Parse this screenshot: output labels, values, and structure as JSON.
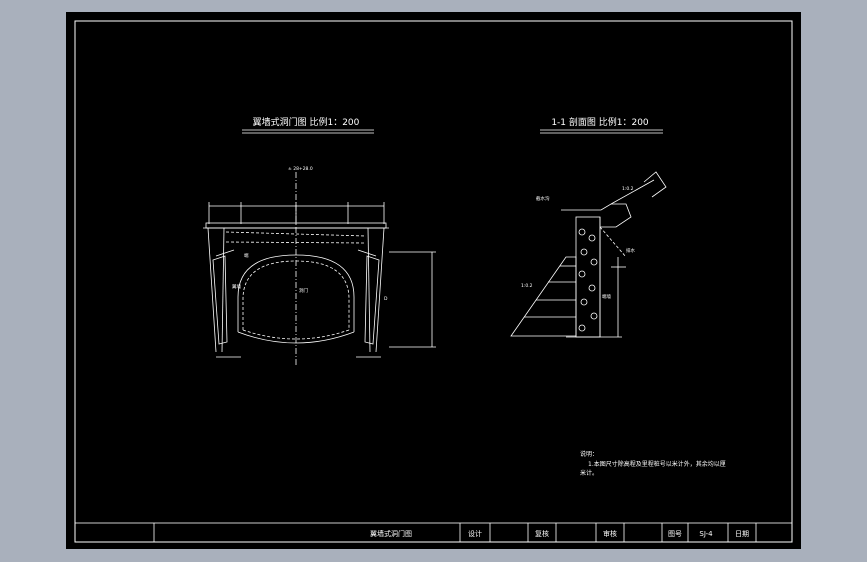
{
  "drawing": {
    "front_view_title": "翼墙式洞门图  比例1：200",
    "section_view_title": "1-1 剖面图  比例1：200",
    "front_dims": {
      "top": "± 28+28.0",
      "ann_a": "端",
      "ann_b": "翼墙",
      "ann_c": "洞门",
      "ann_d": "D"
    },
    "section_labels": {
      "slope_top": "1:0.2",
      "slope_left": "1:0.2",
      "label_a": "截水沟",
      "label_b": "排水",
      "label_c": "端墙"
    },
    "notes": {
      "heading": "说明：",
      "line1": "1.本图尺寸除高程及里程桩号以米计外，其余均以厘",
      "line2": "米计。"
    },
    "title_block": {
      "drawing_name": "翼墙式洞门图",
      "design_label": "设计",
      "check_label": "复核",
      "review_label": "审核",
      "sheet_no_label": "图号",
      "sheet_no_value": "SJ-4",
      "date_label": "日期"
    }
  }
}
